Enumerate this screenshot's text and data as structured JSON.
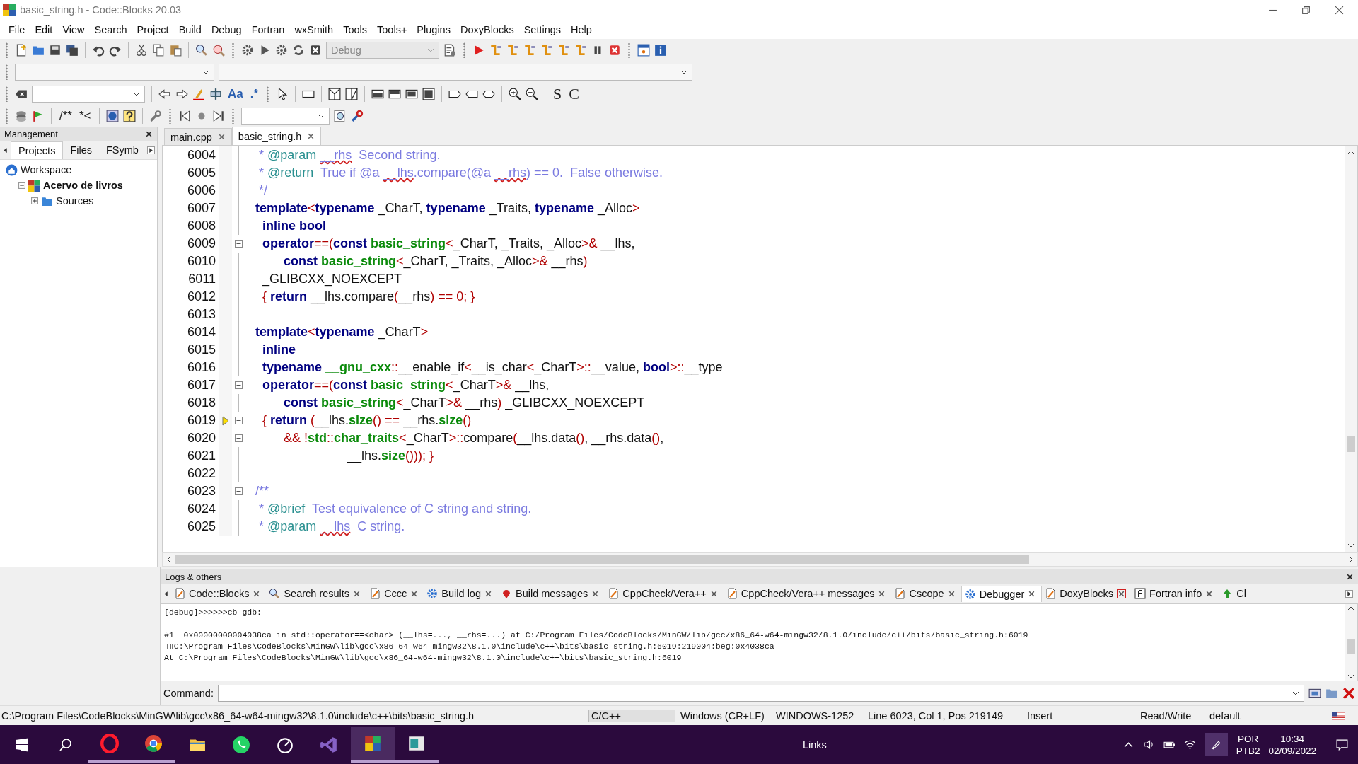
{
  "window": {
    "title": "basic_string.h - Code::Blocks 20.03"
  },
  "menu": [
    "File",
    "Edit",
    "View",
    "Search",
    "Project",
    "Build",
    "Debug",
    "Fortran",
    "wxSmith",
    "Tools",
    "Tools+",
    "Plugins",
    "DoxyBlocks",
    "Settings",
    "Help"
  ],
  "toolbar": {
    "build_target": "Debug",
    "texts": [
      "Aa",
      ".*",
      "S",
      "C",
      "/**",
      "*<"
    ]
  },
  "management": {
    "title": "Management",
    "tabs": [
      {
        "label": "Projects",
        "selected": true
      },
      {
        "label": "Files",
        "selected": false
      },
      {
        "label": "FSymb",
        "selected": false
      }
    ],
    "tree": [
      {
        "label": "Workspace",
        "kind": "workspace",
        "bold": false,
        "children": [
          {
            "label": "Acervo de livros",
            "kind": "project",
            "bold": true,
            "expanded": true,
            "children": [
              {
                "label": "Sources",
                "kind": "folder",
                "bold": false,
                "expanded": false
              }
            ]
          }
        ]
      }
    ]
  },
  "editor": {
    "tabs": [
      {
        "label": "main.cpp",
        "selected": false
      },
      {
        "label": "basic_string.h",
        "selected": true
      }
    ],
    "lines": [
      {
        "number": "6004",
        "fold": false,
        "current": false,
        "segments": [
          {
            "kind": "c",
            "text": " * "
          },
          {
            "kind": "tag",
            "text": "@param "
          },
          {
            "kind": "sp",
            "text": "__rhs"
          },
          {
            "kind": "c",
            "text": "  Second string."
          }
        ]
      },
      {
        "number": "6005",
        "fold": false,
        "current": false,
        "segments": [
          {
            "kind": "c",
            "text": " * "
          },
          {
            "kind": "tag",
            "text": "@return"
          },
          {
            "kind": "c",
            "text": "  True if @a "
          },
          {
            "kind": "sp",
            "text": "__lhs"
          },
          {
            "kind": "c",
            "text": ".compare(@a "
          },
          {
            "kind": "sp",
            "text": "__rhs"
          },
          {
            "kind": "c",
            "text": ") == 0.  False otherwise."
          }
        ]
      },
      {
        "number": "6006",
        "fold": false,
        "current": false,
        "segments": [
          {
            "kind": "c",
            "text": " */"
          }
        ]
      },
      {
        "number": "6007",
        "fold": false,
        "current": false,
        "segments": [
          {
            "kind": "kw",
            "text": "template"
          },
          {
            "kind": "op",
            "text": "<"
          },
          {
            "kind": "kw",
            "text": "typename"
          },
          {
            "kind": "tx",
            "text": " _CharT, "
          },
          {
            "kind": "kw",
            "text": "typename"
          },
          {
            "kind": "tx",
            "text": " _Traits, "
          },
          {
            "kind": "kw",
            "text": "typename"
          },
          {
            "kind": "tx",
            "text": " _Alloc"
          },
          {
            "kind": "op",
            "text": ">"
          }
        ]
      },
      {
        "number": "6008",
        "fold": false,
        "current": false,
        "segments": [
          {
            "kind": "kw",
            "text": "  inline bool"
          }
        ]
      },
      {
        "number": "6009",
        "fold": true,
        "current": false,
        "segments": [
          {
            "kind": "kw",
            "text": "  operator"
          },
          {
            "kind": "op",
            "text": "==("
          },
          {
            "kind": "kw",
            "text": "const "
          },
          {
            "kind": "ty",
            "text": "basic_string"
          },
          {
            "kind": "op",
            "text": "<"
          },
          {
            "kind": "tx",
            "text": "_CharT, _Traits, _Alloc"
          },
          {
            "kind": "op",
            "text": ">&"
          },
          {
            "kind": "tx",
            "text": " __lhs,"
          }
        ]
      },
      {
        "number": "6010",
        "fold": false,
        "current": false,
        "segments": [
          {
            "kind": "kw",
            "text": "        const "
          },
          {
            "kind": "ty",
            "text": "basic_string"
          },
          {
            "kind": "op",
            "text": "<"
          },
          {
            "kind": "tx",
            "text": "_CharT, _Traits, _Alloc"
          },
          {
            "kind": "op",
            "text": ">&"
          },
          {
            "kind": "tx",
            "text": " __rhs"
          },
          {
            "kind": "op",
            "text": ")"
          }
        ]
      },
      {
        "number": "6011",
        "fold": false,
        "current": false,
        "segments": [
          {
            "kind": "tx",
            "text": "  _GLIBCXX_NOEXCEPT"
          }
        ]
      },
      {
        "number": "6012",
        "fold": false,
        "current": false,
        "segments": [
          {
            "kind": "op",
            "text": "  { "
          },
          {
            "kind": "kw",
            "text": "return"
          },
          {
            "kind": "tx",
            "text": " __lhs.compare"
          },
          {
            "kind": "op",
            "text": "("
          },
          {
            "kind": "tx",
            "text": "__rhs"
          },
          {
            "kind": "op",
            "text": ") == 0; }"
          }
        ]
      },
      {
        "number": "6013",
        "fold": false,
        "current": false
      },
      {
        "number": "6014",
        "fold": false,
        "current": false,
        "segments": [
          {
            "kind": "kw",
            "text": "template"
          },
          {
            "kind": "op",
            "text": "<"
          },
          {
            "kind": "kw",
            "text": "typename"
          },
          {
            "kind": "tx",
            "text": " _CharT"
          },
          {
            "kind": "op",
            "text": ">"
          }
        ]
      },
      {
        "number": "6015",
        "fold": false,
        "current": false,
        "segments": [
          {
            "kind": "kw",
            "text": "  inline"
          }
        ]
      },
      {
        "number": "6016",
        "fold": false,
        "current": false,
        "segments": [
          {
            "kind": "kw",
            "text": "  typename "
          },
          {
            "kind": "ty",
            "text": "__gnu_cxx"
          },
          {
            "kind": "op",
            "text": "::"
          },
          {
            "kind": "tx",
            "text": "__enable_if"
          },
          {
            "kind": "op",
            "text": "<"
          },
          {
            "kind": "tx",
            "text": "__is_char"
          },
          {
            "kind": "op",
            "text": "<"
          },
          {
            "kind": "tx",
            "text": "_CharT"
          },
          {
            "kind": "op",
            "text": ">::"
          },
          {
            "kind": "tx",
            "text": "__value, "
          },
          {
            "kind": "kw",
            "text": "bool"
          },
          {
            "kind": "op",
            "text": ">::"
          },
          {
            "kind": "tx",
            "text": "__type"
          }
        ]
      },
      {
        "number": "6017",
        "fold": true,
        "current": false,
        "segments": [
          {
            "kind": "kw",
            "text": "  operator"
          },
          {
            "kind": "op",
            "text": "==("
          },
          {
            "kind": "kw",
            "text": "const "
          },
          {
            "kind": "ty",
            "text": "basic_string"
          },
          {
            "kind": "op",
            "text": "<"
          },
          {
            "kind": "tx",
            "text": "_CharT"
          },
          {
            "kind": "op",
            "text": ">&"
          },
          {
            "kind": "tx",
            "text": " __lhs,"
          }
        ]
      },
      {
        "number": "6018",
        "fold": false,
        "current": false,
        "segments": [
          {
            "kind": "kw",
            "text": "        const "
          },
          {
            "kind": "ty",
            "text": "basic_string"
          },
          {
            "kind": "op",
            "text": "<"
          },
          {
            "kind": "tx",
            "text": "_CharT"
          },
          {
            "kind": "op",
            "text": ">&"
          },
          {
            "kind": "tx",
            "text": " __rhs"
          },
          {
            "kind": "op",
            "text": ")"
          },
          {
            "kind": "tx",
            "text": " _GLIBCXX_NOEXCEPT"
          }
        ]
      },
      {
        "number": "6019",
        "fold": true,
        "current": true,
        "segments": [
          {
            "kind": "op",
            "text": "  { "
          },
          {
            "kind": "kw",
            "text": "return "
          },
          {
            "kind": "op",
            "text": "("
          },
          {
            "kind": "tx",
            "text": "__lhs."
          },
          {
            "kind": "ty",
            "text": "size"
          },
          {
            "kind": "op",
            "text": "() == "
          },
          {
            "kind": "tx",
            "text": "__rhs."
          },
          {
            "kind": "ty",
            "text": "size"
          },
          {
            "kind": "op",
            "text": "()"
          }
        ]
      },
      {
        "number": "6020",
        "fold": true,
        "current": false,
        "segments": [
          {
            "kind": "op",
            "text": "        && !"
          },
          {
            "kind": "ty",
            "text": "std"
          },
          {
            "kind": "op",
            "text": "::"
          },
          {
            "kind": "ty",
            "text": "char_traits"
          },
          {
            "kind": "op",
            "text": "<"
          },
          {
            "kind": "tx",
            "text": "_CharT"
          },
          {
            "kind": "op",
            "text": ">::"
          },
          {
            "kind": "tx",
            "text": "compare"
          },
          {
            "kind": "op",
            "text": "("
          },
          {
            "kind": "tx",
            "text": "__lhs.data"
          },
          {
            "kind": "op",
            "text": "()"
          },
          {
            "kind": "tx",
            "text": ", __rhs.data"
          },
          {
            "kind": "op",
            "text": "()"
          },
          {
            "kind": "tx",
            "text": ","
          }
        ]
      },
      {
        "number": "6021",
        "fold": false,
        "current": false,
        "segments": [
          {
            "kind": "tx",
            "text": "                          __lhs."
          },
          {
            "kind": "ty",
            "text": "size"
          },
          {
            "kind": "op",
            "text": "())); }"
          }
        ]
      },
      {
        "number": "6022",
        "fold": false,
        "current": false
      },
      {
        "number": "6023",
        "fold": true,
        "current": false,
        "segments": [
          {
            "kind": "c",
            "text": "/**"
          }
        ]
      },
      {
        "number": "6024",
        "fold": false,
        "current": false,
        "segments": [
          {
            "kind": "c",
            "text": " * "
          },
          {
            "kind": "tag",
            "text": "@brief"
          },
          {
            "kind": "c",
            "text": "  Test equivalence of C string and string."
          }
        ]
      },
      {
        "number": "6025",
        "fold": false,
        "current": false,
        "segments": [
          {
            "kind": "c",
            "text": " * "
          },
          {
            "kind": "tag",
            "text": "@param "
          },
          {
            "kind": "sp",
            "text": "__lhs"
          },
          {
            "kind": "c",
            "text": "  C string."
          }
        ]
      }
    ]
  },
  "logs": {
    "title": "Logs & others",
    "tabs": [
      {
        "label": "Code::Blocks",
        "selected": false
      },
      {
        "label": "Search results",
        "selected": false
      },
      {
        "label": "Cccc",
        "selected": false
      },
      {
        "label": "Build log",
        "selected": false
      },
      {
        "label": "Build messages",
        "selected": false
      },
      {
        "label": "CppCheck/Vera++",
        "selected": false
      },
      {
        "label": "CppCheck/Vera++ messages",
        "selected": false
      },
      {
        "label": "Cscope",
        "selected": false
      },
      {
        "label": "Debugger",
        "selected": true
      },
      {
        "label": "DoxyBlocks",
        "selected": false
      },
      {
        "label": "Fortran info",
        "selected": false
      },
      {
        "label": "Cl",
        "selected": false
      }
    ],
    "blocks": [
      [
        "[debug]>>>>>>cb_gdb:"
      ],
      [
        "#1  0x00000000004038ca in std::operator==<char> (__lhs=..., __rhs=...) at C:/Program Files/CodeBlocks/MinGW/lib/gcc/x86_64-w64-mingw32/8.1.0/include/c++/bits/basic_string.h:6019",
        "▯▯C:\\Program Files\\CodeBlocks\\MinGW\\lib\\gcc\\x86_64-w64-mingw32\\8.1.0\\include\\c++\\bits\\basic_string.h:6019:219004:beg:0x4038ca",
        "At C:\\Program Files\\CodeBlocks\\MinGW\\lib\\gcc\\x86_64-w64-mingw32\\8.1.0\\include\\c++\\bits\\basic_string.h:6019"
      ]
    ],
    "command_label": "Command:"
  },
  "status_bar": {
    "path": "C:\\Program Files\\CodeBlocks\\MinGW\\lib\\gcc\\x86_64-w64-mingw32\\8.1.0\\include\\c++\\bits\\basic_string.h",
    "items": [
      "C/C++",
      "Windows (CR+LF)",
      "WINDOWS-1252",
      "Line 6023, Col 1, Pos 219149",
      "Insert",
      "Read/Write",
      "default"
    ]
  },
  "taskbar": {
    "apps": [
      {
        "running": true,
        "selected": false
      },
      {
        "running": true,
        "selected": false
      },
      {
        "running": false,
        "selected": false
      },
      {
        "running": false,
        "selected": false
      },
      {
        "running": false,
        "selected": false
      },
      {
        "running": false,
        "selected": false
      },
      {
        "running": true,
        "selected": true
      },
      {
        "running": true,
        "selected": false
      }
    ],
    "links": "Links",
    "language": "POR",
    "layout": "PTB2",
    "time": "10:34",
    "date": "02/09/2022"
  }
}
